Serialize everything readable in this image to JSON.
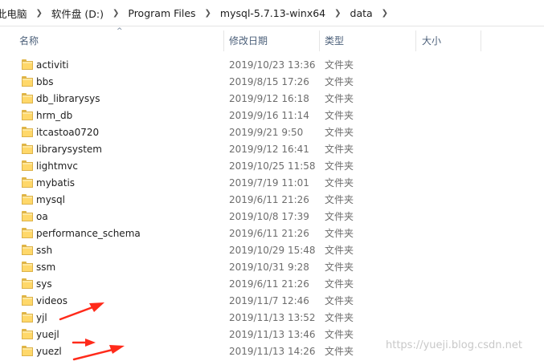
{
  "breadcrumb": [
    {
      "label": "此电脑"
    },
    {
      "label": "软件盘 (D:)"
    },
    {
      "label": "Program Files"
    },
    {
      "label": "mysql-5.7.13-winx64"
    },
    {
      "label": "data"
    }
  ],
  "columns": {
    "name": "名称",
    "modified": "修改日期",
    "type": "类型",
    "size": "大小",
    "sort_indicator": "^"
  },
  "files": [
    {
      "name": "activiti",
      "modified": "2019/10/23 13:36",
      "type": "文件夹"
    },
    {
      "name": "bbs",
      "modified": "2019/8/15 17:26",
      "type": "文件夹"
    },
    {
      "name": "db_librarysys",
      "modified": "2019/9/12 16:18",
      "type": "文件夹"
    },
    {
      "name": "hrm_db",
      "modified": "2019/9/16 11:14",
      "type": "文件夹"
    },
    {
      "name": "itcastoa0720",
      "modified": "2019/9/21 9:50",
      "type": "文件夹"
    },
    {
      "name": "librarysystem",
      "modified": "2019/9/12 16:41",
      "type": "文件夹"
    },
    {
      "name": "lightmvc",
      "modified": "2019/10/25 11:58",
      "type": "文件夹"
    },
    {
      "name": "mybatis",
      "modified": "2019/7/19 11:01",
      "type": "文件夹"
    },
    {
      "name": "mysql",
      "modified": "2019/6/11 21:26",
      "type": "文件夹"
    },
    {
      "name": "oa",
      "modified": "2019/10/8 17:39",
      "type": "文件夹"
    },
    {
      "name": "performance_schema",
      "modified": "2019/6/11 21:26",
      "type": "文件夹"
    },
    {
      "name": "ssh",
      "modified": "2019/10/29 15:48",
      "type": "文件夹"
    },
    {
      "name": "ssm",
      "modified": "2019/10/31 9:28",
      "type": "文件夹"
    },
    {
      "name": "sys",
      "modified": "2019/6/11 21:26",
      "type": "文件夹"
    },
    {
      "name": "videos",
      "modified": "2019/11/7 12:46",
      "type": "文件夹"
    },
    {
      "name": "yjl",
      "modified": "2019/11/13 13:52",
      "type": "文件夹"
    },
    {
      "name": "yuejl",
      "modified": "2019/11/13 13:46",
      "type": "文件夹"
    },
    {
      "name": "yuezl",
      "modified": "2019/11/13 14:26",
      "type": "文件夹"
    }
  ],
  "icons": {
    "folder": "folder-icon",
    "separator": "chevron-right-icon",
    "annotation": "red-arrow-icon"
  },
  "colors": {
    "folder": "#ffd86a",
    "header_text": "#4c607a",
    "annotation": "#ff2a1a"
  },
  "watermark": "https://yueji.blog.csdn.net"
}
